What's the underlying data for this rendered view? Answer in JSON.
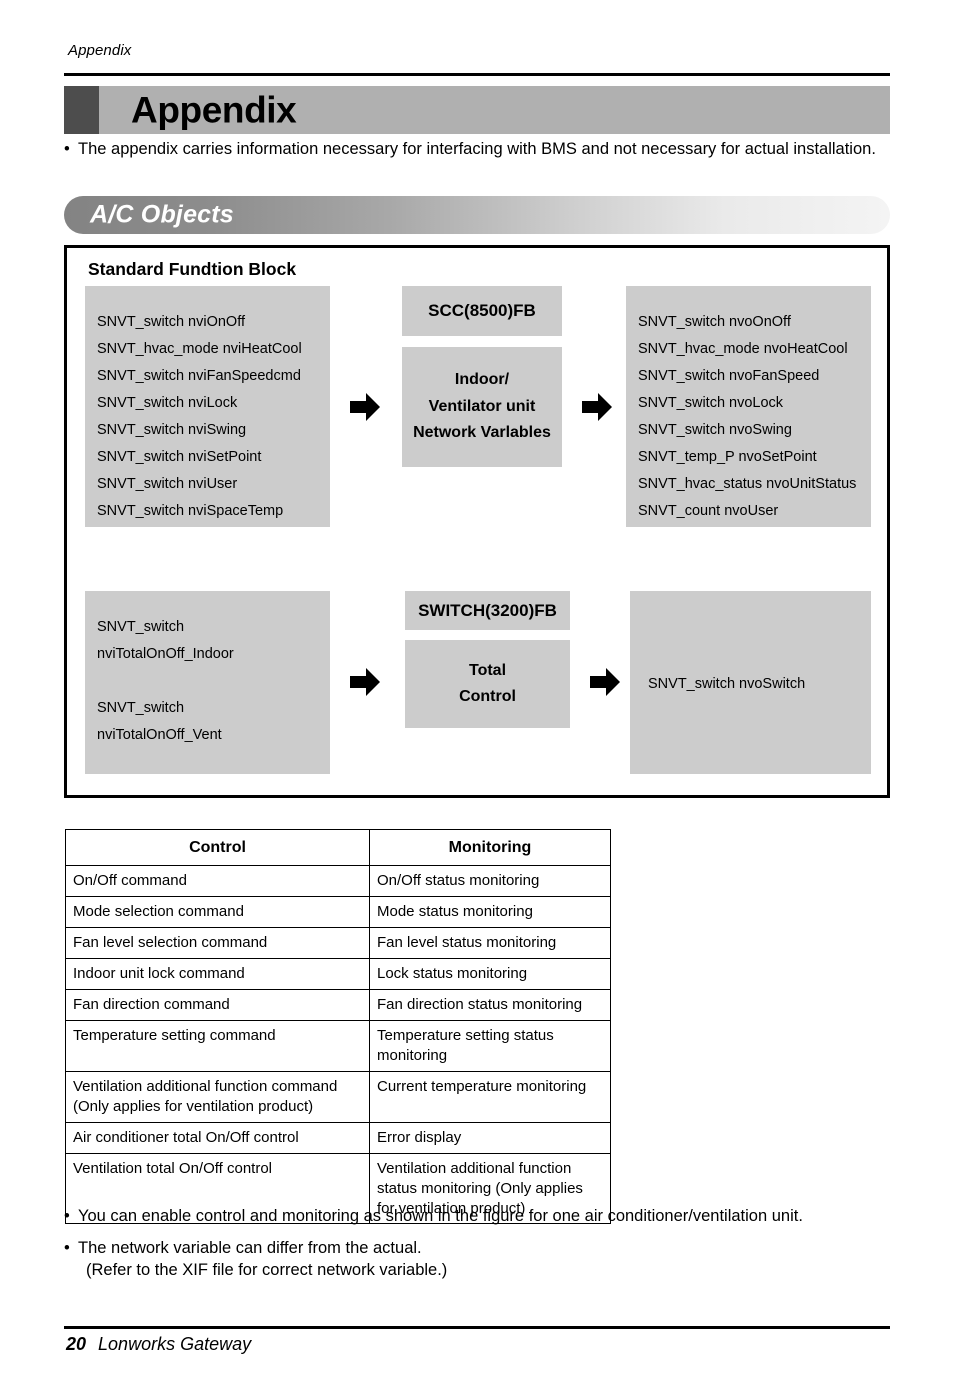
{
  "running_head": "Appendix",
  "chapter": {
    "title": "Appendix",
    "intro_bullet": "•",
    "intro": "The appendix carries information necessary for interfacing with BMS and not necessary for actual installation."
  },
  "banner": {
    "title": "A/C Objects"
  },
  "figure": {
    "title": "Standard Fundtion Block",
    "arrow_icon": "right-arrow-icon",
    "rows": [
      {
        "id": "scc-row",
        "inputs": [
          "SNVT_switch nviOnOff",
          "SNVT_hvac_mode nviHeatCool",
          "SNVT_switch nviFanSpeedcmd",
          "SNVT_switch nviLock",
          "SNVT_switch nviSwing",
          "SNVT_switch nviSetPoint",
          "SNVT_switch nviUser",
          "SNVT_switch nviSpaceTemp"
        ],
        "fb_label": "SCC(8500)FB",
        "fb_body": [
          "Indoor/",
          "Ventilator unit",
          "Network Varlables"
        ],
        "outputs": [
          "SNVT_switch nvoOnOff",
          "SNVT_hvac_mode nvoHeatCool",
          "SNVT_switch nvoFanSpeed",
          "SNVT_switch nvoLock",
          "SNVT_switch nvoSwing",
          "SNVT_temp_P nvoSetPoint",
          "SNVT_hvac_status nvoUnitStatus",
          "SNVT_count nvoUser"
        ]
      },
      {
        "id": "switch-row",
        "inputs": [
          "SNVT_switch",
          "nviTotalOnOff_Indoor",
          "",
          "SNVT_switch",
          "nviTotalOnOff_Vent"
        ],
        "fb_label": "SWITCH(3200)FB",
        "fb_body": [
          "Total",
          "Control"
        ],
        "outputs": [
          "SNVT_switch nvoSwitch"
        ]
      }
    ]
  },
  "table": {
    "headers": [
      "Control",
      "Monitoring"
    ],
    "rows": [
      [
        "On/Off command",
        "On/Off status monitoring"
      ],
      [
        "Mode selection command",
        "Mode status monitoring"
      ],
      [
        "Fan level selection command",
        "Fan level status monitoring"
      ],
      [
        "Indoor unit lock command",
        "Lock status monitoring"
      ],
      [
        "Fan direction command",
        "Fan direction status monitoring"
      ],
      [
        "Temperature setting command",
        "Temperature setting status monitoring"
      ],
      [
        "Ventilation additional function command (Only applies for ventilation product)",
        "Current temperature monitoring"
      ],
      [
        "Air conditioner total On/Off control",
        "Error display"
      ],
      [
        "Ventilation total On/Off control",
        "Ventilation additional function status monitoring (Only applies for ventilation product)"
      ]
    ]
  },
  "notes": [
    {
      "bullet": "•",
      "text": "You can enable control and monitoring as shown in the figure for one air conditioner/ventilation unit.",
      "sub": ""
    },
    {
      "bullet": "•",
      "text": "The network variable can differ from the actual.",
      "sub": "(Refer to the XIF file for correct network variable.)"
    }
  ],
  "footer": {
    "page_number": "20",
    "doc_name": "Lonworks Gateway"
  }
}
